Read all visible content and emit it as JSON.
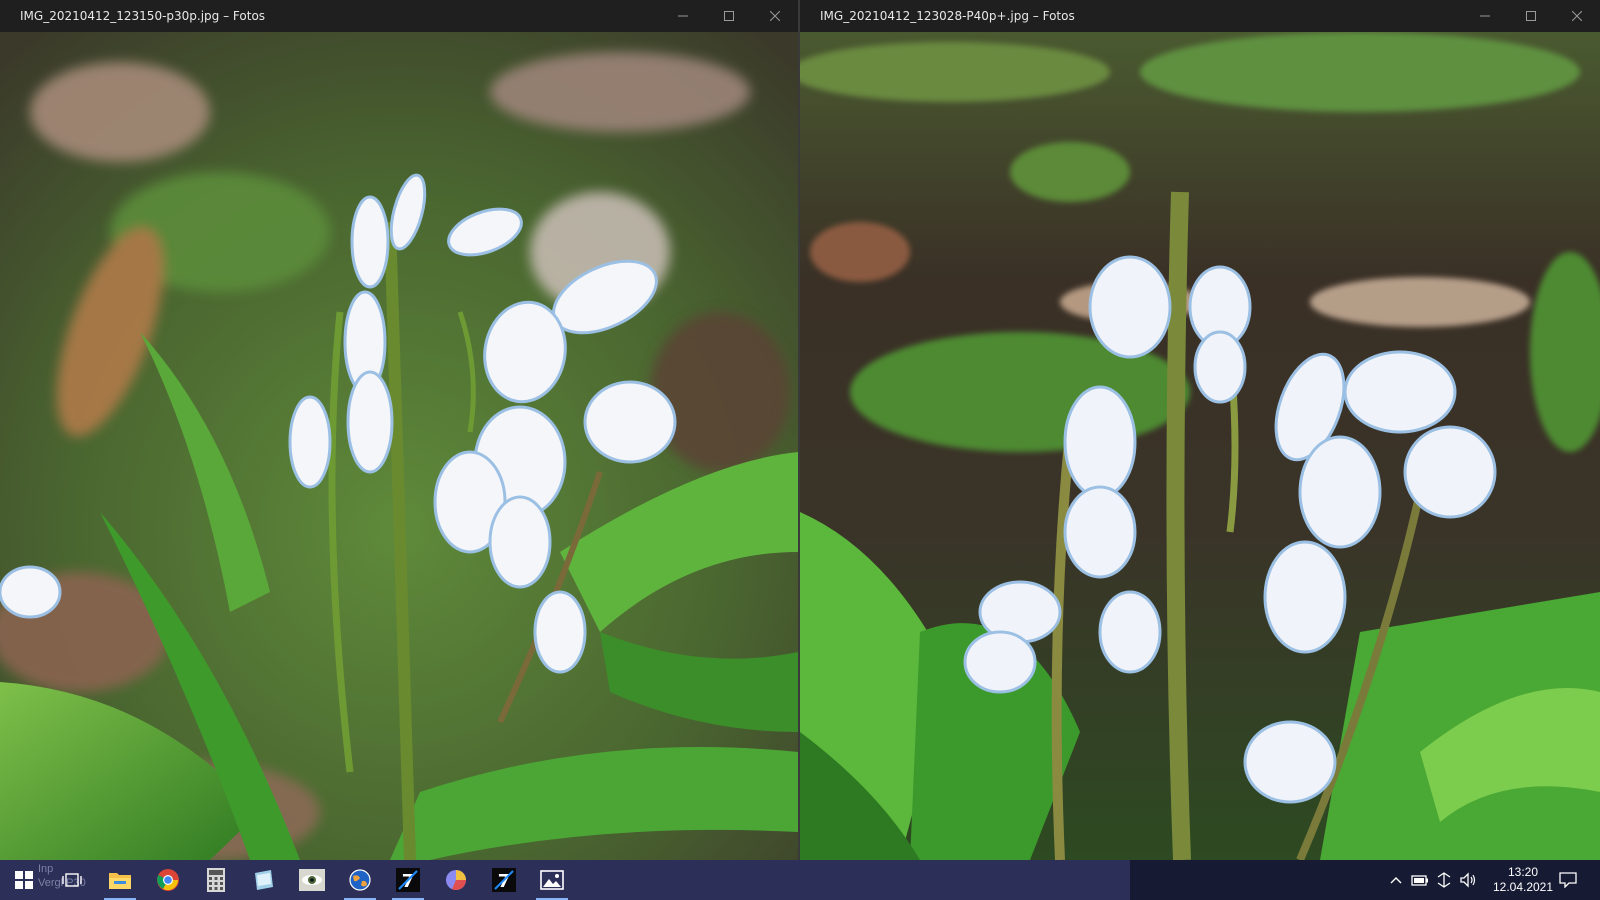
{
  "left_window": {
    "title": "IMG_20210412_123150-p30p.jpg – Fotos",
    "photo_subject": "white-blue squill flowers among green leaves"
  },
  "right_window": {
    "title": "IMG_20210412_123028-P40p+.jpg – Fotos",
    "photo_subject": "white-blue squill flowers among green leaves"
  },
  "window_controls": {
    "minimize": "minimize-icon",
    "maximize": "maximize-icon",
    "close": "close-icon"
  },
  "taskbar": {
    "ghost_text_1": "Inp",
    "ghost_text_2": "Vergl   P30",
    "apps": [
      "windows-start-icon",
      "task-view-icon",
      "file-explorer-icon",
      "chrome-icon",
      "calculator-icon",
      "notebook-icon",
      "eye-app-icon",
      "globe-app-icon",
      "seven-app-icon-1",
      "chart-app-icon",
      "seven-app-icon-2",
      "photos-icon"
    ],
    "active_apps": [
      "file-explorer-icon",
      "globe-app-icon",
      "seven-app-icon-1",
      "photos-icon"
    ],
    "time": "13:20",
    "date": "12.04.2021"
  },
  "colors": {
    "taskbar_bg": "#161a33",
    "titlebar_bg": "#1f1f1f",
    "accent": "#8ab4f8"
  }
}
